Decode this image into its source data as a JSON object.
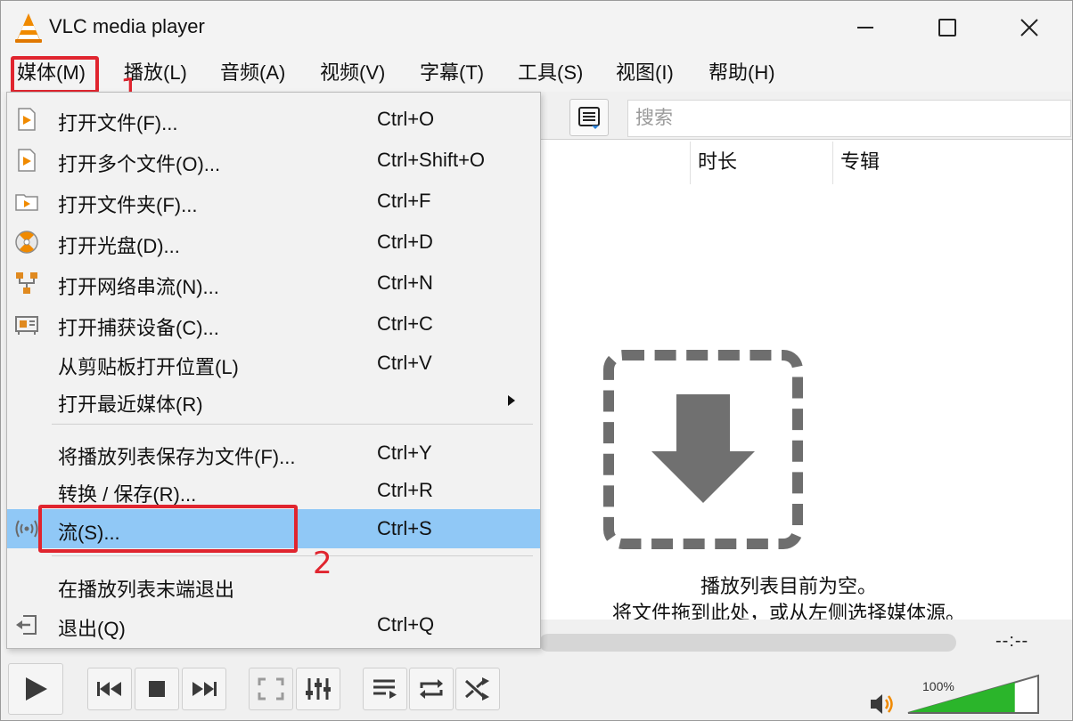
{
  "window": {
    "title": "VLC media player"
  },
  "menubar": [
    {
      "label": "媒体(M)"
    },
    {
      "label": "播放(L)"
    },
    {
      "label": "音频(A)"
    },
    {
      "label": "视频(V)"
    },
    {
      "label": "字幕(T)"
    },
    {
      "label": "工具(S)"
    },
    {
      "label": "视图(I)"
    },
    {
      "label": "帮助(H)"
    }
  ],
  "annotations": {
    "step1": "1",
    "step2": "2",
    "color": "#e0252f"
  },
  "media_menu": {
    "items": [
      {
        "label": "打开文件(F)...",
        "accel": "Ctrl+O",
        "icon": "file-play-icon"
      },
      {
        "label": "打开多个文件(O)...",
        "accel": "Ctrl+Shift+O",
        "icon": "file-play-icon"
      },
      {
        "label": "打开文件夹(F)...",
        "accel": "Ctrl+F",
        "icon": "folder-play-icon"
      },
      {
        "label": "打开光盘(D)...",
        "accel": "Ctrl+D",
        "icon": "disc-icon"
      },
      {
        "label": "打开网络串流(N)...",
        "accel": "Ctrl+N",
        "icon": "network-icon"
      },
      {
        "label": "打开捕获设备(C)...",
        "accel": "Ctrl+C",
        "icon": "capture-card-icon"
      },
      {
        "label": "从剪贴板打开位置(L)",
        "accel": "Ctrl+V",
        "icon": ""
      },
      {
        "label": "打开最近媒体(R)",
        "accel": "",
        "icon": "",
        "submenu": true
      },
      {
        "label": "将播放列表保存为文件(F)...",
        "accel": "Ctrl+Y",
        "icon": ""
      },
      {
        "label": "转换 / 保存(R)...",
        "accel": "Ctrl+R",
        "icon": ""
      },
      {
        "label": "流(S)...",
        "accel": "Ctrl+S",
        "icon": "stream-icon",
        "highlighted": true
      },
      {
        "label": "在播放列表末端退出",
        "accel": "",
        "icon": ""
      },
      {
        "label": "退出(Q)",
        "accel": "Ctrl+Q",
        "icon": "exit-icon"
      }
    ],
    "highlight_color": "#90c8f6"
  },
  "playlist": {
    "search_placeholder": "搜索",
    "columns": [
      "时长",
      "专辑"
    ],
    "empty_title": "播放列表目前为空。",
    "empty_hint": "将文件拖到此处，或从左侧选择媒体源。"
  },
  "controls": {
    "time": "--:--",
    "volume": "100%",
    "volume_level": 1.0,
    "accent": "#2bb52b"
  }
}
